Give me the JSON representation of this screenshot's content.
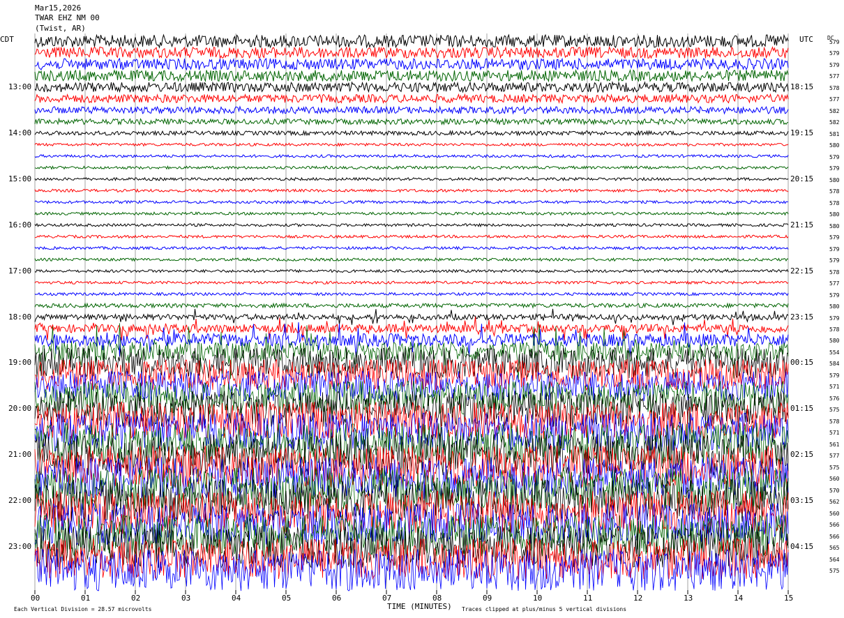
{
  "header": {
    "date": "Mar15,2026",
    "station": "TWAR EHZ NM 00",
    "location": "(Twist, AR)"
  },
  "left_zone_label": "CDT",
  "right_zone_label": "UTC",
  "dc_label": "DC",
  "footer": {
    "scale_note": "Each Vertical Division = 28.57 microvolts",
    "xlabel": "TIME (MINUTES)",
    "clip_note": "Traces clipped at plus/minus 5 vertical divisions"
  },
  "colors": {
    "trace_cycle": [
      "#000000",
      "#ff0000",
      "#0000ff",
      "#006400"
    ],
    "grid": "#666666"
  },
  "chart_data": {
    "type": "line",
    "title": "",
    "xlabel": "TIME (MINUTES)",
    "x_ticks": [
      "00",
      "01",
      "02",
      "03",
      "04",
      "05",
      "06",
      "07",
      "08",
      "09",
      "10",
      "11",
      "12",
      "13",
      "14",
      "15"
    ],
    "xlim": [
      0,
      15
    ],
    "left_hour_labels": [
      "13:00",
      "14:00",
      "15:00",
      "16:00",
      "17:00",
      "18:00",
      "19:00",
      "20:00",
      "21:00",
      "22:00",
      "23:00"
    ],
    "right_hour_labels": [
      "18:15",
      "19:15",
      "20:15",
      "21:15",
      "22:15",
      "23:15",
      "00:15",
      "01:15",
      "02:15",
      "03:15",
      "04:15"
    ],
    "dc_offsets": [
      "579",
      "579",
      "579",
      "577",
      "578",
      "577",
      "582",
      "582",
      "581",
      "580",
      "579",
      "579",
      "580",
      "578",
      "578",
      "580",
      "580",
      "579",
      "579",
      "579",
      "578",
      "577",
      "579",
      "580",
      "579",
      "578",
      "580",
      "554",
      "584",
      "579",
      "571",
      "576",
      "575",
      "578",
      "571",
      "561",
      "577",
      "575",
      "560",
      "570",
      "562",
      "560",
      "566",
      "566",
      "565",
      "564",
      "575"
    ],
    "trace_amplitude": [
      9,
      8,
      8,
      8,
      7,
      6,
      5,
      4,
      3,
      2,
      2,
      2,
      2,
      2,
      2,
      2,
      2,
      2,
      2,
      2,
      2,
      2,
      2,
      3,
      4,
      6,
      9,
      14,
      22,
      22,
      22,
      24,
      26,
      27,
      28,
      30,
      30,
      30,
      30,
      31,
      31,
      31,
      30,
      30,
      30,
      30,
      30
    ]
  }
}
